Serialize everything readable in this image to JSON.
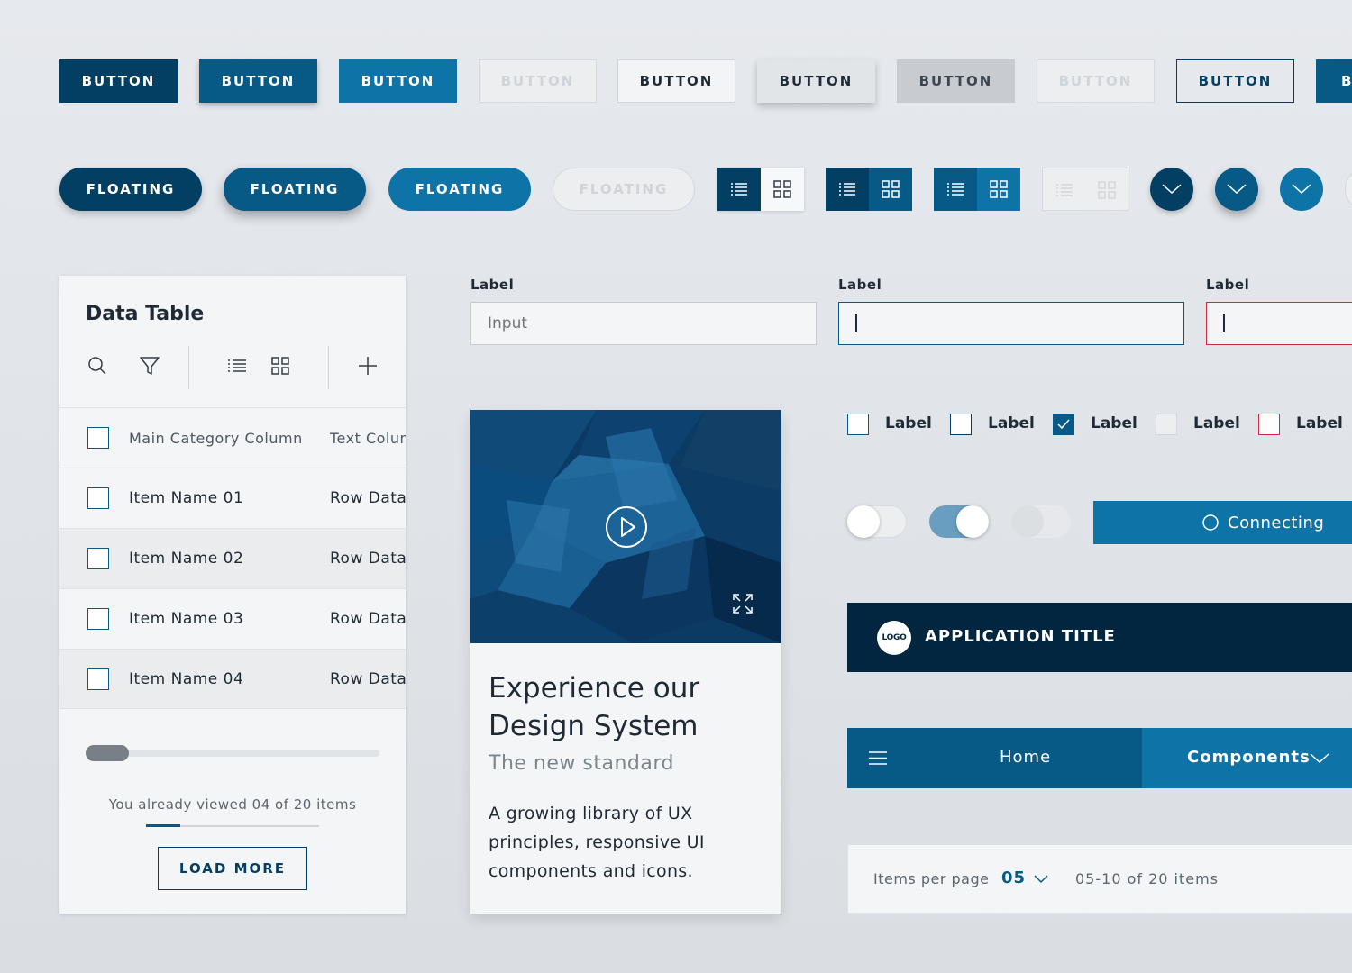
{
  "buttons_row": [
    {
      "label": "BUTTON",
      "style": "dark"
    },
    {
      "label": "BUTTON",
      "style": "mid"
    },
    {
      "label": "BUTTON",
      "style": "light"
    },
    {
      "label": "BUTTON",
      "style": "disabled"
    },
    {
      "label": "BUTTON",
      "style": "white"
    },
    {
      "label": "BUTTON",
      "style": "white-raised"
    },
    {
      "label": "BUTTON",
      "style": "gray"
    },
    {
      "label": "BUTTON",
      "style": "disabled"
    },
    {
      "label": "BUTTON",
      "style": "outline"
    },
    {
      "label": "B",
      "style": "cut"
    }
  ],
  "floating_row": [
    {
      "label": "FLOATING",
      "style": "dark"
    },
    {
      "label": "FLOATING",
      "style": "mid"
    },
    {
      "label": "FLOATING",
      "style": "light"
    },
    {
      "label": "FLOATING",
      "style": "disabled"
    }
  ],
  "icons": {
    "list": "list-icon",
    "grid": "grid-icon",
    "chevron": "chevron-down-icon",
    "search": "search-icon",
    "filter": "filter-icon",
    "add": "plus-icon",
    "play": "play-icon",
    "expand": "expand-icon",
    "menu": "menu-icon",
    "spinner": "spinner-icon"
  },
  "colors": {
    "primary_dark": "#033e63",
    "primary": "#065a85",
    "primary_light": "#0e73a6",
    "error": "#d6283a",
    "app_bar": "#02263f"
  },
  "data_table": {
    "title": "Data Table",
    "columns": [
      "Main Category Column",
      "Text Colum"
    ],
    "rows": [
      {
        "name": "Item Name 01",
        "data": "Row Data"
      },
      {
        "name": "Item Name 02",
        "data": "Row Data"
      },
      {
        "name": "Item Name 03",
        "data": "Row Data"
      },
      {
        "name": "Item Name 04",
        "data": "Row Data"
      }
    ],
    "viewed_text": "You already viewed 04 of 20 items",
    "viewed_fraction": 0.2,
    "load_more": "LOAD MORE"
  },
  "fields": [
    {
      "label": "Label",
      "placeholder": "Input",
      "state": "default"
    },
    {
      "label": "Label",
      "value": "",
      "state": "focus"
    },
    {
      "label": "Label",
      "value": "",
      "state": "error"
    }
  ],
  "media_card": {
    "title": "Experience our Design System",
    "subtitle": "The new standard",
    "description": "A growing library of UX principles, responsive UI components and icons."
  },
  "checkboxes": [
    {
      "label": "Label",
      "state": "unchecked"
    },
    {
      "label": "Label",
      "state": "unchecked-dark"
    },
    {
      "label": "Label",
      "state": "checked"
    },
    {
      "label": "Label",
      "state": "disabled"
    },
    {
      "label": "Label",
      "state": "error"
    }
  ],
  "toggles": [
    {
      "state": "off"
    },
    {
      "state": "on"
    },
    {
      "state": "disabled"
    }
  ],
  "connecting_label": "Connecting",
  "app_bar": {
    "logo": "LOGO",
    "title": "APPLICATION TITLE"
  },
  "nav": {
    "home": "Home",
    "components": "Components"
  },
  "pagination": {
    "label": "Items per page",
    "value": "05",
    "range": "05-10 of 20 items"
  }
}
